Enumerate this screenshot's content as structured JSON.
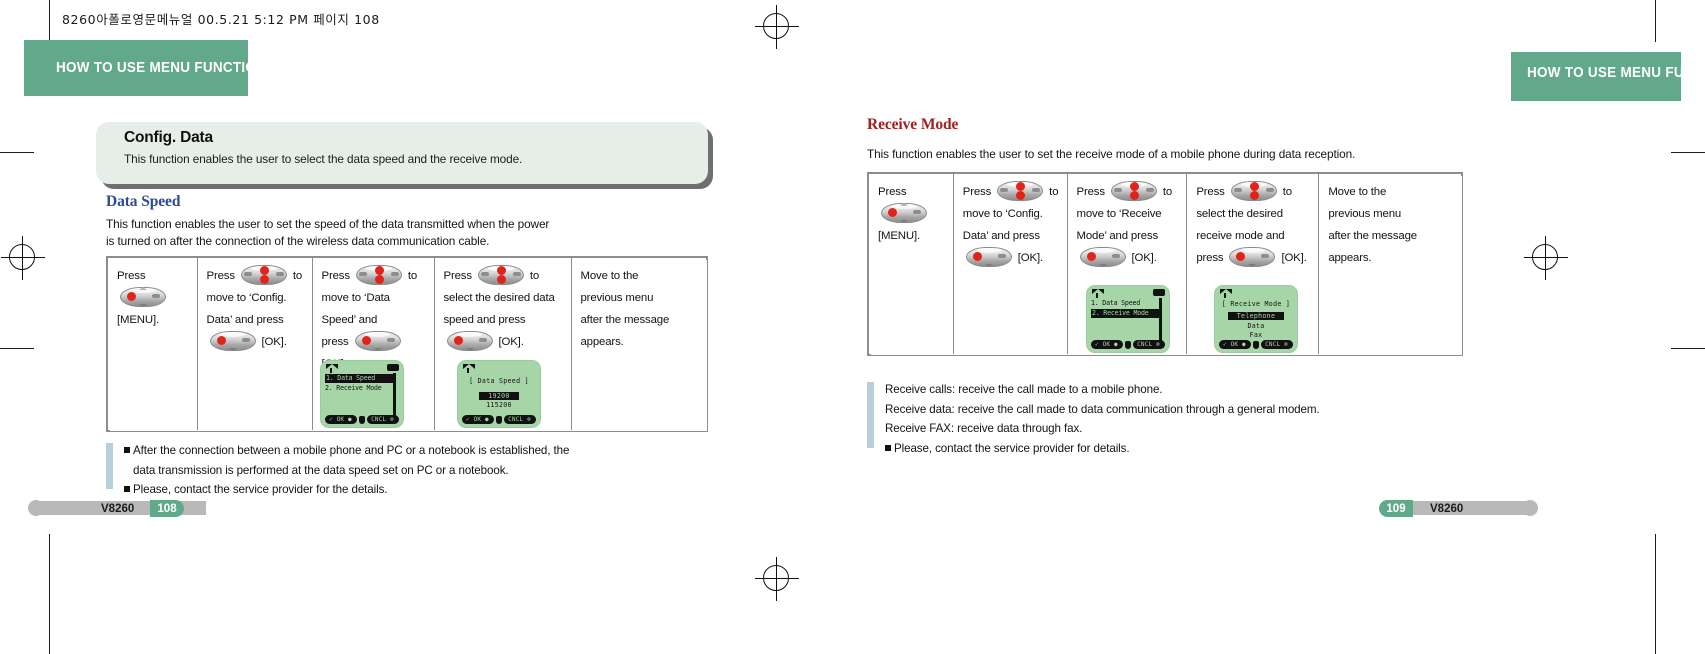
{
  "slug": "8260아폴로영문메뉴얼   00.5.21 5:12 PM 페이지 108",
  "header": {
    "left_title": "HOW TO USE MENU FUNCTIONS",
    "right_title": "HOW TO USE MENU FUNCTIONS",
    "accent_color": "#62a98c"
  },
  "left_page": {
    "callout": {
      "title": "Config. Data",
      "description": "This function enables the user to select the data speed and the receive mode."
    },
    "section": {
      "title": "Data Speed",
      "title_color": "#2a4b9b",
      "paragraph_line1": "This function enables the user to set the speed of the data transmitted when the power",
      "paragraph_line2": "is turned on after the connection of the wireless data communication cable."
    },
    "steps": [
      {
        "lines": [
          "Press  [key-ok]",
          "[MENU]."
        ]
      },
      {
        "lines": [
          "Press  [key-ud]  to",
          "move to  ‘Config.",
          "Data’ and press",
          "[key-ok]  [OK]."
        ]
      },
      {
        "lines": [
          "Press  [key-ud] to",
          "move to  ‘Data",
          "Speed’  and",
          "press  [key-ok]  [OK]."
        ]
      },
      {
        "lines": [
          "Press  [key-ud] to",
          "select the desired data",
          "speed and press",
          "[key-ok]  [OK]."
        ]
      },
      {
        "lines": [
          "Move to the",
          "previous menu",
          "after the message",
          "appears."
        ]
      }
    ],
    "screens": [
      {
        "name": "config-data-menu",
        "type": "list",
        "rows": [
          {
            "text": "1. Data Speed",
            "selected": true
          },
          {
            "text": "2. Receive Mode",
            "selected": false
          }
        ],
        "soft_left": "OK",
        "soft_right": "CNCL"
      },
      {
        "name": "data-speed-list",
        "type": "titled-list",
        "title": "[ Data Speed ]",
        "rows": [
          {
            "text": "19200",
            "selected": true
          },
          {
            "text": "115200",
            "selected": false
          }
        ],
        "soft_left": "OK",
        "soft_right": "CNCL"
      }
    ],
    "note": [
      "After the connection between a mobile phone and PC or a notebook is established, the",
      "data transmission is performed at the data speed set on PC or a notebook.",
      "Please, contact the service provider for the details."
    ],
    "footer": {
      "model": "V8260",
      "page": "108"
    }
  },
  "right_page": {
    "section": {
      "title": "Receive Mode",
      "title_color": "#a02020",
      "paragraph": "This function enables the user  to set the receive mode  of a mobile phone during  data reception."
    },
    "steps": [
      {
        "lines": [
          "Press  [key-ok]",
          "[MENU]."
        ]
      },
      {
        "lines": [
          "Press  [key-ud] to",
          "move to  ‘Config.",
          "Data’ and press",
          "[key-ok]  [OK]."
        ]
      },
      {
        "lines": [
          "Press  [key-ud] to",
          "move to  ‘Receive",
          "Mode’ and press",
          "[key-ok]  [OK]."
        ]
      },
      {
        "lines": [
          "Press  [key-ud] to",
          "select the desired",
          "receive mode and",
          "press  [key-ok]  [OK]."
        ]
      },
      {
        "lines": [
          "Move to the",
          "previous menu",
          "after the message",
          "appears."
        ]
      }
    ],
    "screens": [
      {
        "name": "config-data-menu",
        "type": "list",
        "rows": [
          {
            "text": "1. Data Speed",
            "selected": false
          },
          {
            "text": "2. Receive Mode",
            "selected": true
          }
        ],
        "soft_left": "OK",
        "soft_right": "CNCL"
      },
      {
        "name": "receive-mode-list",
        "type": "titled-list",
        "title": "[ Receive Mode ]",
        "rows": [
          {
            "text": "Telephone",
            "selected": true
          },
          {
            "text": "Data",
            "selected": false
          },
          {
            "text": "Fax",
            "selected": false
          }
        ],
        "soft_left": "OK",
        "soft_right": "CNCL"
      }
    ],
    "note": [
      "Receive calls: receive the call made to a mobile phone.",
      "Receive data: receive the call made to data communication through a general modem.",
      "Receive FAX: receive data through fax.",
      "Please, contact the service provider for details."
    ],
    "footer": {
      "model": "V8260",
      "page": "109"
    }
  }
}
